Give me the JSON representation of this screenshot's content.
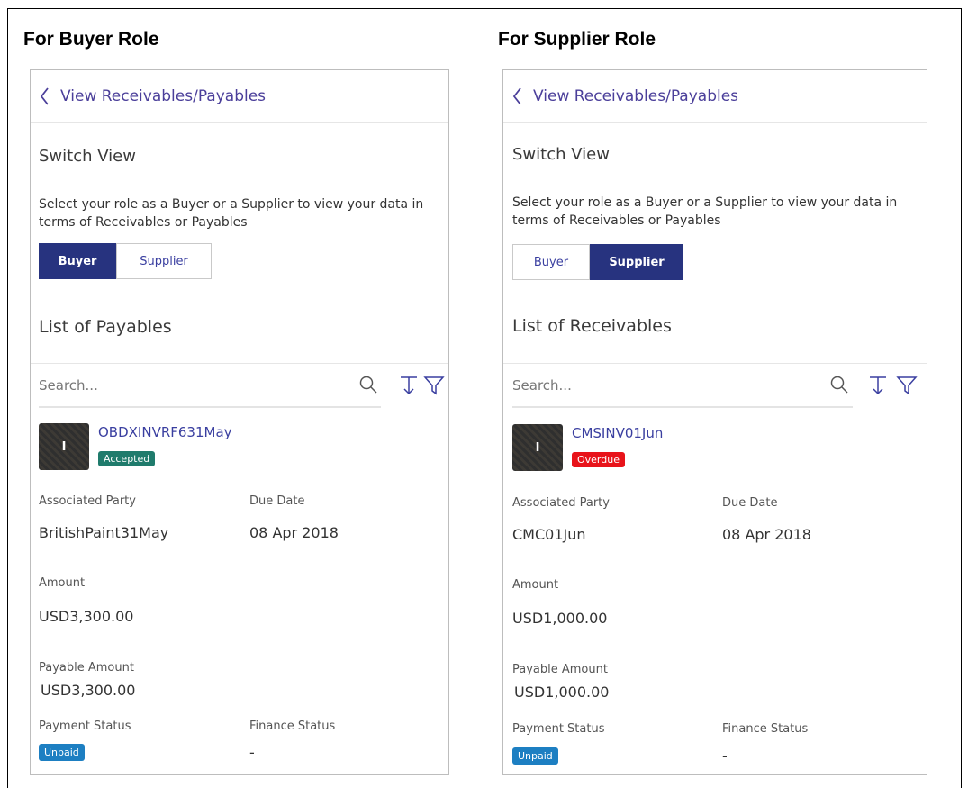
{
  "panels": [
    {
      "heading": "For Buyer Role",
      "nav_title": "View Receivables/Payables",
      "switch_view_title": "Switch View",
      "description": "Select your role as a Buyer or a Supplier to view your data in terms of Receivables or Payables",
      "toggle": {
        "buyer_label": "Buyer",
        "supplier_label": "Supplier",
        "selected": "Buyer"
      },
      "list_title": "List of Payables",
      "search_placeholder": "Search...",
      "item": {
        "avatar_letter": "I",
        "title": "OBDXINVRF631May",
        "status_badge": "Accepted",
        "status_color": "#1f7b6c",
        "associated_party_label": "Associated Party",
        "associated_party": "BritishPaint31May",
        "due_date_label": "Due Date",
        "due_date": "08 Apr 2018",
        "amount_label": "Amount",
        "amount": "USD3,300.00",
        "payable_amount_label": "Payable Amount",
        "payable_amount": "USD3,300.00",
        "payment_status_label": "Payment Status",
        "payment_status": "Unpaid",
        "payment_status_color": "#1d7fc2",
        "finance_status_label": "Finance Status",
        "finance_status": "-"
      }
    },
    {
      "heading": "For Supplier Role",
      "nav_title": "View Receivables/Payables",
      "switch_view_title": "Switch View",
      "description": "Select your role as a Buyer or a Supplier to view your data in terms of Receivables or Payables",
      "toggle": {
        "buyer_label": "Buyer",
        "supplier_label": "Supplier",
        "selected": "Supplier"
      },
      "list_title": "List of Receivables",
      "search_placeholder": "Search...",
      "item": {
        "avatar_letter": "I",
        "title": "CMSINV01Jun",
        "status_badge": "Overdue",
        "status_color": "#e8131a",
        "associated_party_label": "Associated Party",
        "associated_party": "CMC01Jun",
        "due_date_label": "Due Date",
        "due_date": "08 Apr 2018",
        "amount_label": "Amount",
        "amount": "USD1,000.00",
        "payable_amount_label": "Payable Amount",
        "payable_amount": "USD1,000.00",
        "payment_status_label": "Payment Status",
        "payment_status": "Unpaid",
        "payment_status_color": "#1d7fc2",
        "finance_status_label": "Finance Status",
        "finance_status": "-"
      }
    }
  ],
  "icons": {
    "back": "chevron-left-icon",
    "search": "search-icon",
    "sort": "sort-icon",
    "filter": "filter-icon"
  }
}
